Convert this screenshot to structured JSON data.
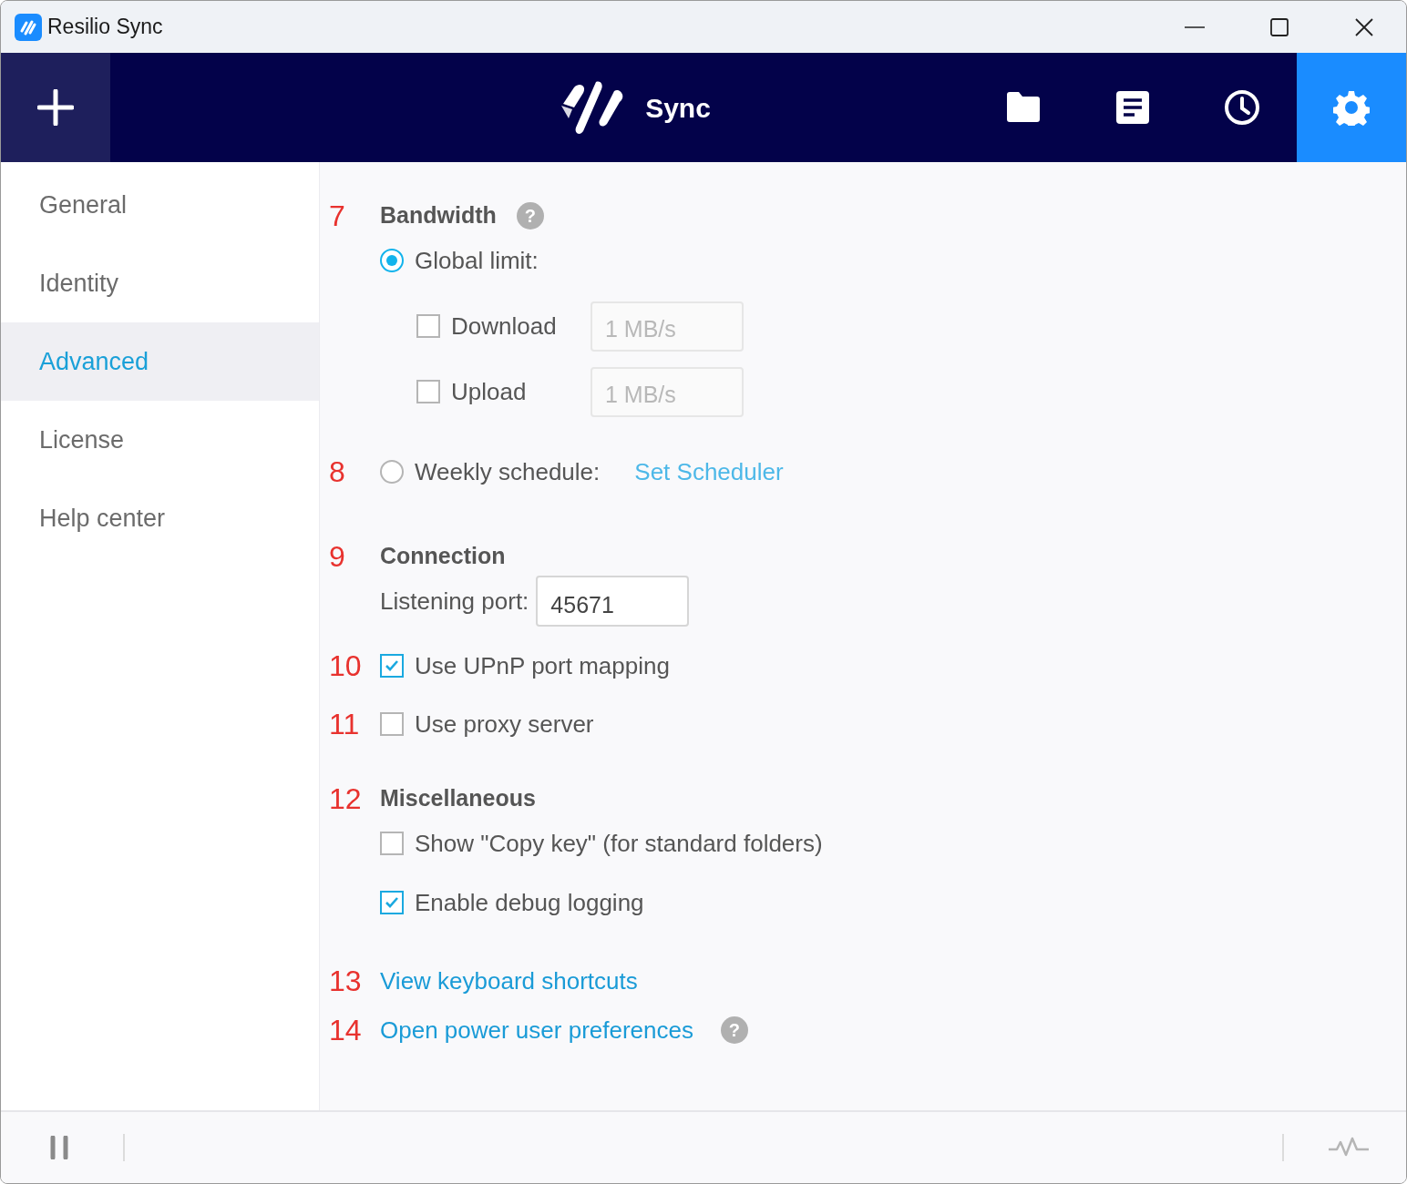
{
  "window": {
    "title": "Resilio Sync"
  },
  "toolbar": {
    "logo_text": "Sync",
    "tabs": [
      {
        "kind": "folders",
        "selected": false
      },
      {
        "kind": "log",
        "selected": false
      },
      {
        "kind": "history",
        "selected": false
      },
      {
        "kind": "settings",
        "selected": true
      }
    ]
  },
  "sidebar": {
    "items": [
      {
        "label": "General",
        "selected": false
      },
      {
        "label": "Identity",
        "selected": false
      },
      {
        "label": "Advanced",
        "selected": true
      },
      {
        "label": "License",
        "selected": false
      },
      {
        "label": "Help center",
        "selected": false
      }
    ]
  },
  "bandwidth": {
    "marker": "7",
    "title": "Bandwidth",
    "help": "?",
    "global_limit": {
      "label": "Global limit:",
      "selected": true
    },
    "limits": [
      {
        "label": "Download",
        "checked": false,
        "placeholder": "1 MB/s"
      },
      {
        "label": "Upload",
        "checked": false,
        "placeholder": "1 MB/s"
      }
    ],
    "weekly": {
      "marker": "8",
      "label": "Weekly schedule:",
      "selected": false,
      "link": "Set Scheduler"
    }
  },
  "connection": {
    "marker": "9",
    "title": "Connection",
    "port_label": "Listening port:",
    "port": "45671",
    "options": [
      {
        "marker": "10",
        "label": "Use UPnP port mapping",
        "checked": true
      },
      {
        "marker": "11",
        "label": "Use proxy server",
        "checked": false
      }
    ]
  },
  "misc": {
    "marker": "12",
    "title": "Miscellaneous",
    "options": [
      {
        "label": "Show \"Copy key\" (for standard folders)",
        "checked": false
      },
      {
        "label": "Enable debug logging",
        "checked": true
      }
    ]
  },
  "links": [
    {
      "marker": "13",
      "label": "View keyboard shortcuts"
    },
    {
      "marker": "14",
      "label": "Open power user preferences",
      "help": "?"
    }
  ]
}
